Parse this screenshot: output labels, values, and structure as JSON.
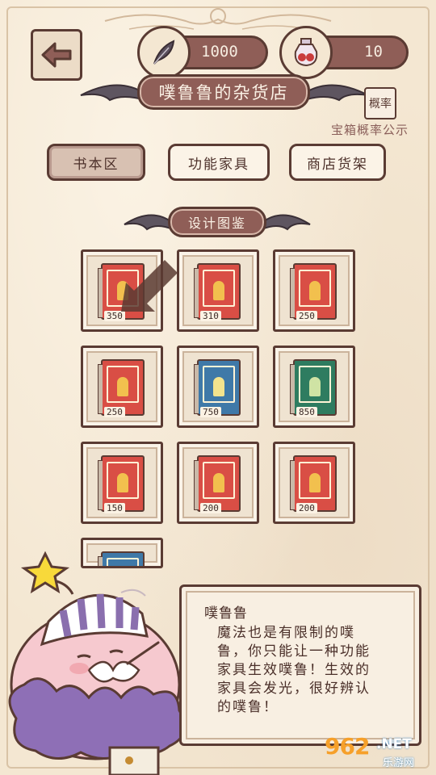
{
  "header": {
    "back_icon": "left-arrow-icon",
    "feather": {
      "icon": "feather-icon",
      "value": "1000"
    },
    "potion": {
      "icon": "potion-bottle-icon",
      "value": "10"
    }
  },
  "shop": {
    "title": "噗鲁鲁的杂货店",
    "prob_button": "概率",
    "prob_note": "宝箱概率公示"
  },
  "tabs": [
    {
      "label": "书本区",
      "active": true
    },
    {
      "label": "功能家具",
      "active": false
    },
    {
      "label": "商店货架",
      "active": false
    }
  ],
  "section": {
    "title": "设计图鉴"
  },
  "items": [
    {
      "price": "350",
      "cover": "#d94e45",
      "emblem": "#f2c04e"
    },
    {
      "price": "310",
      "cover": "#d94e45",
      "emblem": "#f2c04e"
    },
    {
      "price": "250",
      "cover": "#d94e45",
      "emblem": "#f2c04e"
    },
    {
      "price": "250",
      "cover": "#d94e45",
      "emblem": "#f2c04e"
    },
    {
      "price": "750",
      "cover": "#3f79a8",
      "emblem": "#f3e38d"
    },
    {
      "price": "850",
      "cover": "#2e7c60",
      "emblem": "#cfe3a4"
    },
    {
      "price": "150",
      "cover": "#d94e45",
      "emblem": "#f2c04e"
    },
    {
      "price": "200",
      "cover": "#d94e45",
      "emblem": "#f2c04e"
    },
    {
      "price": "200",
      "cover": "#d94e45",
      "emblem": "#f2c04e"
    },
    {
      "price": "",
      "cover": "#3f79a8",
      "emblem": "#f3e38d"
    }
  ],
  "dialog": {
    "speaker": "噗鲁鲁",
    "message": "魔法也是有限制的噗鲁，你只能让一种功能家具生效噗鲁！生效的家具会发光，很好辨认的噗鲁！"
  },
  "watermark": {
    "number": "962",
    "net": ".NET",
    "site": "乐游网"
  },
  "colors": {
    "accent": "#8f5e57",
    "outline": "#5a3b33",
    "paper": "#f4e7d2"
  }
}
